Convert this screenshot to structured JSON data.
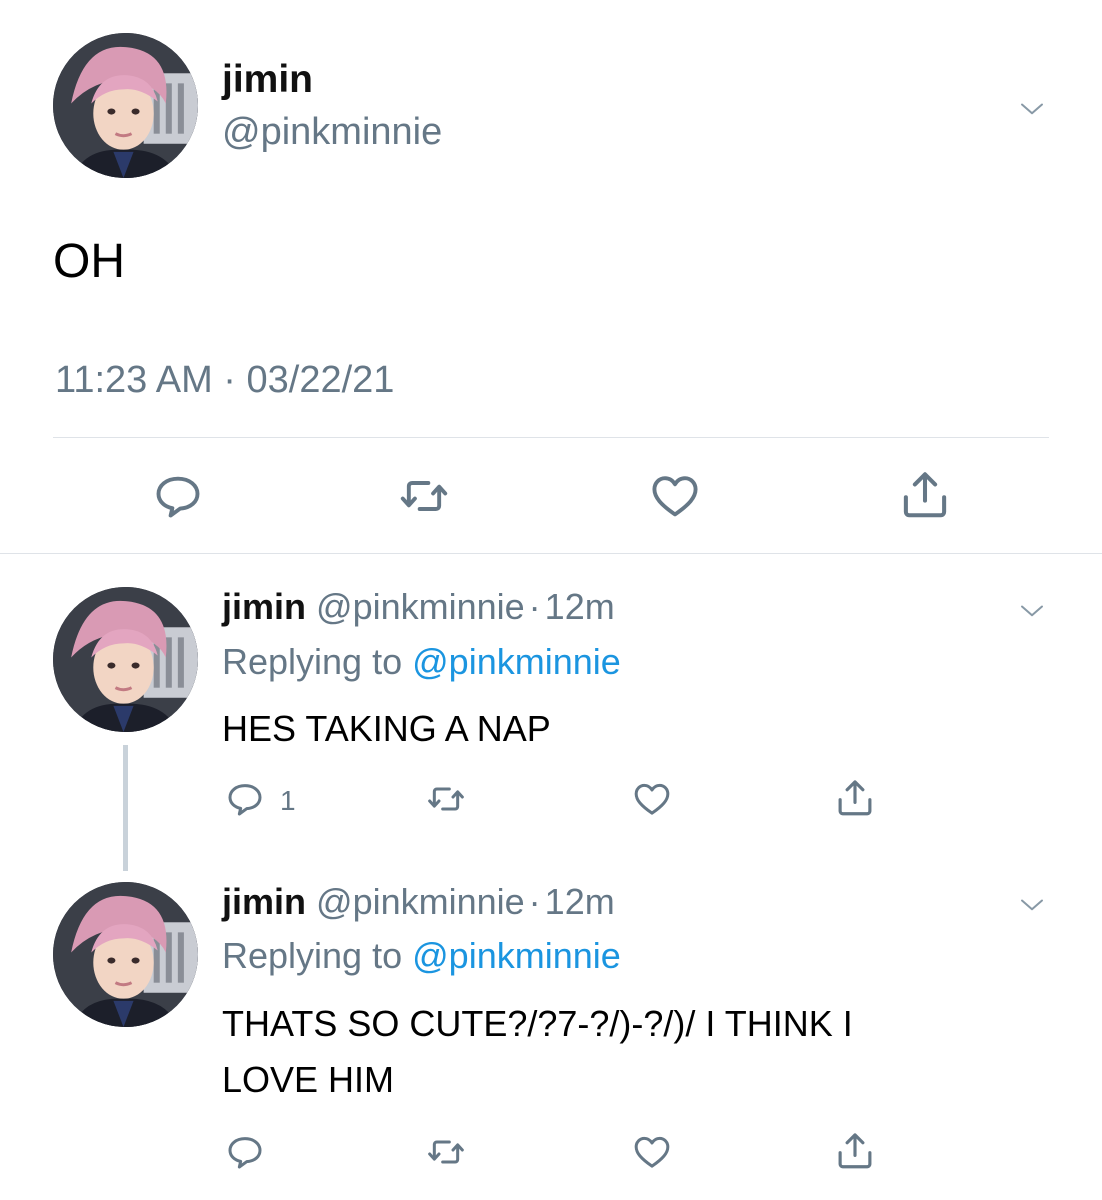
{
  "main_tweet": {
    "display_name": "jimin",
    "handle": "@pinkminnie",
    "text": "OH",
    "timestamp": "11:23 AM · 03/22/21"
  },
  "replies": [
    {
      "display_name": "jimin",
      "handle": "@pinkminnie",
      "separator": "·",
      "time_ago": "12m",
      "replying_prefix": "Replying to",
      "replying_handle": "@pinkminnie",
      "text": "HES TAKING A NAP",
      "reply_count": "1"
    },
    {
      "display_name": "jimin",
      "handle": "@pinkminnie",
      "separator": "·",
      "time_ago": "12m",
      "replying_prefix": "Replying to",
      "replying_handle": "@pinkminnie",
      "text_line1": "THATS SO CUTE?/?7-?/)-?/)/ I THINK I",
      "text_line2": "LOVE HIM",
      "reply_count": ""
    }
  ],
  "icons": {
    "reply": "reply-icon",
    "retweet": "retweet-icon",
    "like": "heart-icon",
    "share": "share-icon",
    "menu": "chevron-down-icon"
  },
  "colors": {
    "text_gray": "#657786",
    "link_blue": "#1b95e0",
    "divider": "#dfe3e8",
    "thread_line": "#c9d2da"
  }
}
